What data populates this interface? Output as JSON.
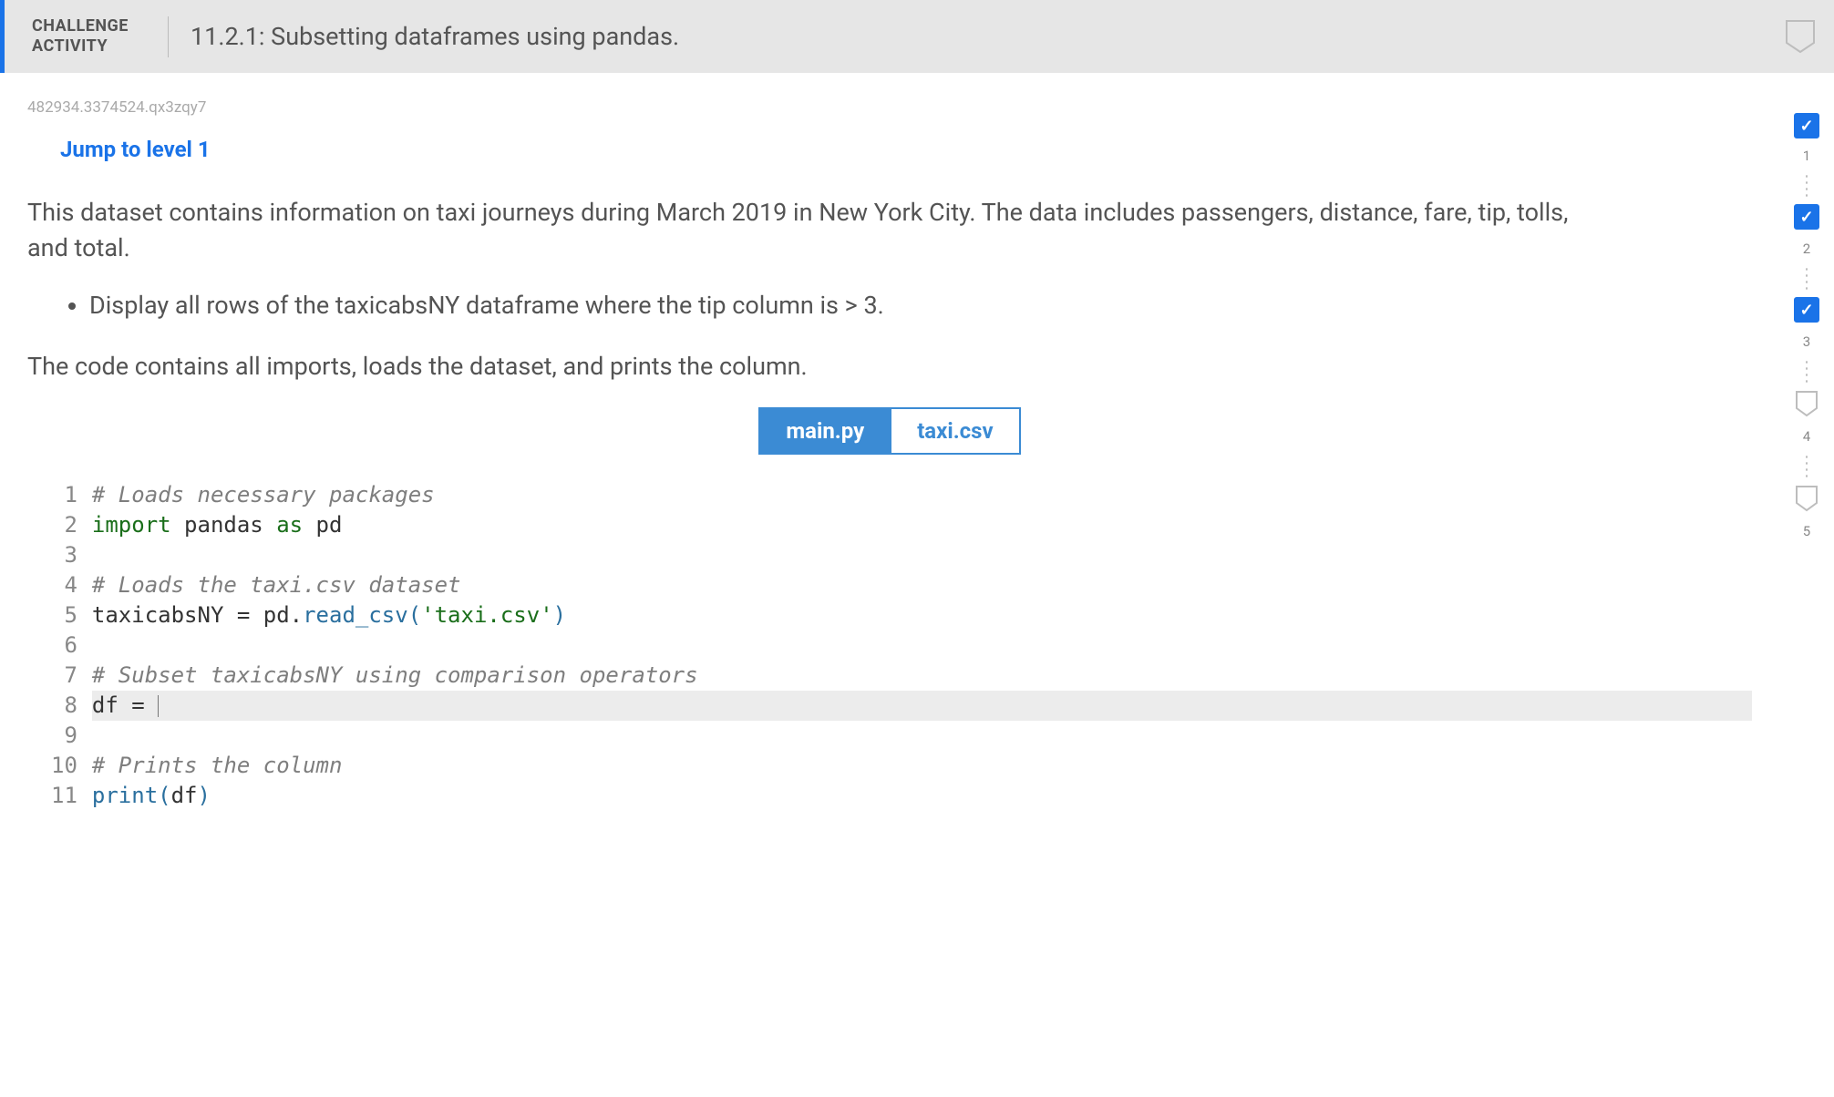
{
  "header": {
    "challenge_label_line1": "CHALLENGE",
    "challenge_label_line2": "ACTIVITY",
    "title": "11.2.1: Subsetting dataframes using pandas."
  },
  "instance_id": "482934.3374524.qx3zqy7",
  "jump_link": "Jump to level 1",
  "desc": {
    "p1": "This dataset contains information on taxi journeys during March 2019 in New York City. The data includes passengers, distance, fare, tip, tolls, and total.",
    "bullet1": "Display all rows of the taxicabsNY dataframe where the tip column is > 3.",
    "p2": "The code contains all imports, loads the dataset, and prints the column."
  },
  "tabs": {
    "main": "main.py",
    "csv": "taxi.csv"
  },
  "code": {
    "l1": "# Loads necessary packages",
    "l2_kw": "import",
    "l2_mid": " pandas ",
    "l2_as": "as",
    "l2_pd": " pd",
    "l3": "",
    "l4": "# Loads the taxi.csv dataset",
    "l5_a": "taxicabsNY = pd",
    "l5_dot": ".",
    "l5_fn": "read_csv",
    "l5_p1": "(",
    "l5_str": "'taxi.csv'",
    "l5_p2": ")",
    "l6": "",
    "l7": "# Subset taxicabsNY using comparison operators",
    "l8": "df = ",
    "l9": "",
    "l10": "# Prints the column",
    "l11_fn": "print",
    "l11_p1": "(",
    "l11_arg": "df",
    "l11_p2": ")"
  },
  "gutter": [
    "1",
    "2",
    "3",
    "4",
    "5",
    "6",
    "7",
    "8",
    "9",
    "10",
    "11"
  ],
  "progress": [
    {
      "num": "",
      "done": true
    },
    {
      "num": "1",
      "done": false,
      "is_sep": true
    },
    {
      "num": "",
      "done": true
    },
    {
      "num": "2",
      "done": false,
      "is_sep": true
    },
    {
      "num": "",
      "done": true
    },
    {
      "num": "3",
      "done": false,
      "is_sep": true
    }
  ],
  "levels": {
    "n1": "1",
    "n2": "2",
    "n3": "3",
    "n4": "4",
    "n5": "5"
  },
  "check": "✓"
}
